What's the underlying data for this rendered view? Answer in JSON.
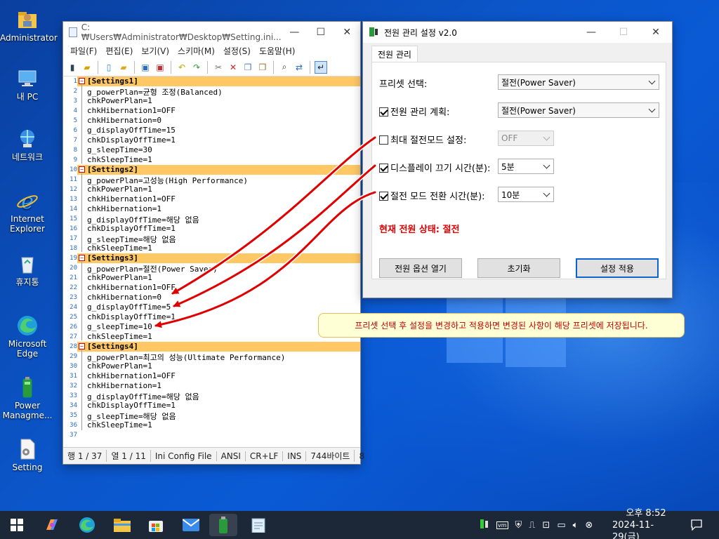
{
  "desktop": {
    "icons": [
      {
        "label": "Administrator"
      },
      {
        "label": "내 PC"
      },
      {
        "label": "네트워크"
      },
      {
        "label": "Internet\nExplorer"
      },
      {
        "label": "휴지통"
      },
      {
        "label": "Microsoft\nEdge"
      },
      {
        "label": "Power\nManagme..."
      },
      {
        "label": "Setting"
      }
    ]
  },
  "notepad": {
    "title": "C:₩Users₩Administrator₩Desktop₩Setting.ini...",
    "menu": [
      "파일(F)",
      "편집(E)",
      "보기(V)",
      "스키마(M)",
      "설정(S)",
      "도움말(H)"
    ],
    "lines": [
      "[Settings1]",
      "g_powerPlan=균형 조정(Balanced)",
      "chkPowerPlan=1",
      "chkHibernation1=OFF",
      "chkHibernation=0",
      "g_displayOffTime=15",
      "chkDisplayOffTime=1",
      "g_sleepTime=30",
      "chkSleepTime=1",
      "[Settings2]",
      "g_powerPlan=고성능(High Performance)",
      "chkPowerPlan=1",
      "chkHibernation1=OFF",
      "chkHibernation=1",
      "g_displayOffTime=해당 없음",
      "chkDisplayOffTime=1",
      "g_sleepTime=해당 없음",
      "chkSleepTime=1",
      "[Settings3]",
      "g_powerPlan=절전(Power Saver)",
      "chkPowerPlan=1",
      "chkHibernation1=OFF",
      "chkHibernation=0",
      "g_displayOffTime=5",
      "chkDisplayOffTime=1",
      "g_sleepTime=10",
      "chkSleepTime=1",
      "[Settings4]",
      "g_powerPlan=최고의 성능(Ultimate Performance)",
      "chkPowerPlan=1",
      "chkHibernation1=OFF",
      "chkHibernation=1",
      "g_displayOffTime=해당 없음",
      "chkDisplayOffTime=1",
      "g_sleepTime=해당 없음",
      "chkSleepTime=1",
      ""
    ],
    "status": {
      "line": "행 1 / 37",
      "col": "열 1 / 11",
      "filetype": "Ini Config File",
      "encoding": "ANSI",
      "eol": "CR+LF",
      "mode": "INS",
      "size": "744바이트",
      "extra": "8"
    }
  },
  "power": {
    "title": "전원 관리 설정 v2.0",
    "tab": "전원 관리",
    "preset_label": "프리셋 선택:",
    "preset_value": "절전(Power Saver)",
    "plan_label": "전원 관리 계획:",
    "plan_value": "절전(Power Saver)",
    "hib_label": "최대 절전모드 설정:",
    "hib_value": "OFF",
    "display_label": "디스플레이 끄기 시간(분):",
    "display_value": "5분",
    "sleep_label": "절전 모드 전환 시간(분):",
    "sleep_value": "10분",
    "status_text": "현재 전원 상태: 절전",
    "btn_open": "전원 옵션 열기",
    "btn_reset": "초기화",
    "btn_apply": "설정 적용"
  },
  "callout": "프리셋 선택 후 설정을 변경하고 적용하면 변경된 사항이 해당 프리셋에 저장됩니다.",
  "taskbar": {
    "time": "오후 8:52",
    "date": "2024-11-29(금)"
  },
  "colors": {
    "accent": "#0a64d0",
    "highlight": "#ffc864",
    "warning": "#d00000"
  }
}
